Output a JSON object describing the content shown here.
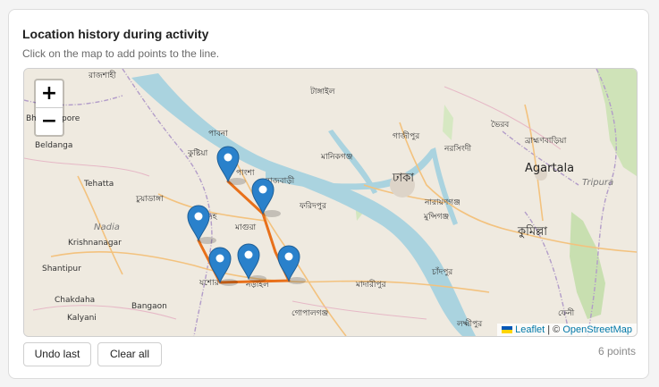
{
  "card": {
    "title": "Location history during activity",
    "subtitle": "Click on the map to add points to the line."
  },
  "map": {
    "zoom_in_label": "+",
    "zoom_out_label": "−",
    "attribution": {
      "leaflet": "Leaflet",
      "separator": " | © ",
      "osm": "OpenStreetMap"
    },
    "labels": {
      "rajshahi": "রাজশাহী",
      "tangail": "টাঙ্গাইল",
      "bhalukapore": "Bhalu",
      "pore": "pore",
      "pabna": "পাবনা",
      "gazipur": "গাজীপুর",
      "bhairab": "ভৈরব",
      "brahmanbaria": "ব্রাহ্মণবাড়িয়া",
      "beldanga": "Beldanga",
      "kushtia": "কুষ্টিয়া",
      "manikganj": "মানিকগঞ্জ",
      "narsingdi": "নরসিংদী",
      "agartala": "Agartala",
      "pangsha": "পাংশা",
      "rajbari": "রাজবাড়ী",
      "tehatta": "Tehatta",
      "dhaka": "ঢাকা",
      "tripura": "Tripura",
      "chuadanga": "চুয়াডাঙ্গা",
      "narayanganj": "নারায়ণগঞ্জ",
      "faridpur": "ফরিদপুর",
      "jhenaidah": "দহ",
      "munshiganj": "মুন্সিগঞ্জ",
      "nadia": "Nadia",
      "magura": "মাগুরা",
      "krishnanagar": "Krishnanagar",
      "cumilla": "কুমিল্লা",
      "shantipur": "Shantipur",
      "chandpur": "চাঁদপুর",
      "jashore": "যশোর",
      "narail": "নড়াইল",
      "madaripur": "মাদারীপুর",
      "chakdaha": "Chakdaha",
      "bangaon": "Bangaon",
      "gopalganj": "গোপালগঞ্জ",
      "kalyani": "Kalyani",
      "lakshmipur": "লক্ষ্মীপুর",
      "feni": "ফেনী"
    },
    "route_color": "#e8701a",
    "marker_color": "#2a81cb"
  },
  "actions": {
    "undo_label": "Undo last",
    "clear_label": "Clear all",
    "points_count": "6 points"
  }
}
